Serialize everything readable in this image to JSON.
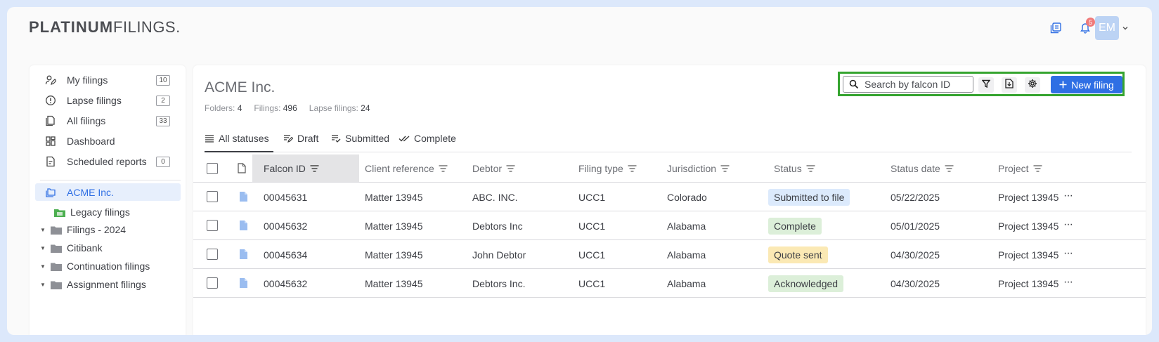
{
  "header": {
    "logo_bold": "PLATINUM",
    "logo_rest": "FILINGS.",
    "notification_count": "5",
    "avatar_initials": "EM"
  },
  "sidebar": {
    "items": [
      {
        "label": "My filings",
        "count": "10",
        "icon": "user-edit-icon"
      },
      {
        "label": "Lapse filings",
        "count": "2",
        "icon": "alert-circle-icon"
      },
      {
        "label": "All filings",
        "count": "33",
        "icon": "documents-icon"
      },
      {
        "label": "Dashboard",
        "count": "",
        "icon": "dashboard-icon"
      },
      {
        "label": "Scheduled reports",
        "count": "0",
        "icon": "report-icon"
      }
    ],
    "active_folder": "ACME Inc.",
    "tree": [
      {
        "label": "Legacy filings",
        "expandable": false
      },
      {
        "label": "Filings - 2024",
        "expandable": true
      },
      {
        "label": "Citibank",
        "expandable": true
      },
      {
        "label": "Continuation filings",
        "expandable": true
      },
      {
        "label": "Assignment filings",
        "expandable": true
      }
    ]
  },
  "main": {
    "title": "ACME Inc.",
    "stats": [
      {
        "label": "Folders:",
        "value": "4"
      },
      {
        "label": "Filings:",
        "value": "496"
      },
      {
        "label": "Lapse filings:",
        "value": "24"
      }
    ],
    "search_placeholder": "Search by falcon ID",
    "new_filing_label": "New filing",
    "tabs": [
      "All statuses",
      "Draft",
      "Submitted",
      "Complete"
    ],
    "columns": [
      "Falcon ID",
      "Client reference",
      "Debtor",
      "Filing type",
      "Jurisdiction",
      "Status",
      "Status date",
      "Project"
    ],
    "rows": [
      {
        "falcon_id": "00045631",
        "client_ref": "Matter 13945",
        "debtor": "ABC. INC.",
        "filing_type": "UCC1",
        "jurisdiction": "Colorado",
        "status": "Submitted to file",
        "status_date": "05/22/2025",
        "project": "Project 13945"
      },
      {
        "falcon_id": "00045632",
        "client_ref": "Matter 13945",
        "debtor": "Debtors Inc",
        "filing_type": "UCC1",
        "jurisdiction": "Alabama",
        "status": "Complete",
        "status_date": "05/01/2025",
        "project": "Project 13945"
      },
      {
        "falcon_id": "00045634",
        "client_ref": "Matter 13945",
        "debtor": "John Debtor",
        "filing_type": "UCC1",
        "jurisdiction": "Alabama",
        "status": "Quote sent",
        "status_date": "04/30/2025",
        "project": "Project 13945"
      },
      {
        "falcon_id": "00045632",
        "client_ref": "Matter 13945",
        "debtor": "Debtors Inc.",
        "filing_type": "UCC1",
        "jurisdiction": "Alabama",
        "status": "Acknowledged",
        "status_date": "04/30/2025",
        "project": "Project 13945"
      }
    ]
  },
  "colors": {
    "accent": "#2f6fe4",
    "highlight_outline": "#35a42f",
    "status_submitted_bg": "#dceafc",
    "status_complete_bg": "#dcefd9",
    "status_quote_bg": "#fbe9b4",
    "status_ack_bg": "#dcefd9"
  }
}
